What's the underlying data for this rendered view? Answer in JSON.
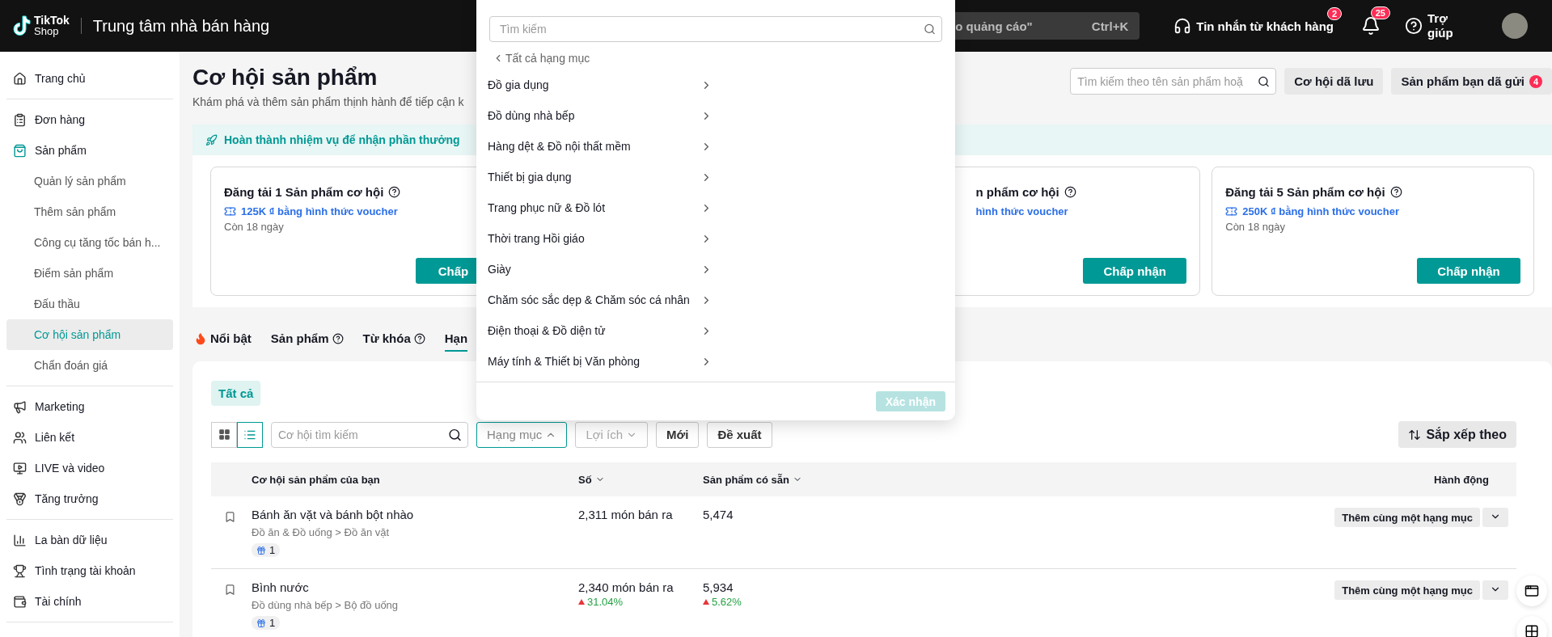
{
  "header": {
    "logo": "TikTok",
    "logo_sub": "Shop",
    "title": "Trung tâm nhà bán hàng",
    "search": {
      "value": "o quảng cáo\"",
      "shortcut": "Ctrl+K"
    },
    "messages": {
      "label": "Tin nhắn từ khách hàng",
      "badge": "2"
    },
    "notifications": {
      "badge": "25"
    },
    "help": {
      "label": "Trợ giúp"
    }
  },
  "sidebar": {
    "groups": [
      [
        {
          "label": "Trang chủ",
          "selected": false
        }
      ],
      [
        {
          "label": "Đơn hàng",
          "selected": false
        },
        {
          "label": "Sản phẩm",
          "selected": false,
          "expanded": true,
          "children": [
            {
              "label": "Quản lý sản phẩm",
              "selected": false
            },
            {
              "label": "Thêm sản phẩm",
              "selected": false
            },
            {
              "label": "Công cụ tăng tốc bán h...",
              "selected": false
            },
            {
              "label": "Điểm sản phẩm",
              "selected": false
            },
            {
              "label": "Đấu thầu",
              "selected": false
            },
            {
              "label": "Cơ hội sản phẩm",
              "selected": true
            },
            {
              "label": "Chẩn đoán giá",
              "selected": false
            }
          ]
        }
      ],
      [
        {
          "label": "Marketing",
          "selected": false
        },
        {
          "label": "Liên kết",
          "selected": false
        },
        {
          "label": "LIVE và video",
          "selected": false
        },
        {
          "label": "Tăng trưởng",
          "selected": false
        }
      ],
      [
        {
          "label": "La bàn dữ liệu",
          "selected": false
        },
        {
          "label": "Tình trạng tài khoản",
          "selected": false
        },
        {
          "label": "Tài chính",
          "selected": false
        }
      ]
    ]
  },
  "page": {
    "title": "Cơ hội sản phẩm",
    "subtitle": "Khám phá và thêm sản phẩm thịnh hành để tiếp cận k",
    "search": {
      "placeholder": "Tìm kiếm theo tên sản phẩm hoặ"
    },
    "buttons": [
      {
        "label": "Cơ hội dã lưu"
      },
      {
        "label": "Sản phẩm bạn dã gửi",
        "badge": "4"
      }
    ]
  },
  "mission": {
    "title": "Hoàn thành nhiệm vụ để nhận phần thưởng",
    "cards": [
      {
        "kind": "full",
        "title": "Đăng tải 1 Sản phẩm cơ hội",
        "voucher": "125K ₫ bằng hình thức voucher",
        "days": "Còn 18 ngày",
        "button": "Chấp"
      },
      {
        "kind": "cut",
        "title": "n phẩm cơ hội",
        "voucher": "hình thức voucher",
        "button": "Chấp nhận"
      },
      {
        "kind": "full",
        "title": "Đăng tải 5 Sản phẩm cơ hội",
        "voucher": "250K ₫ bằng hình thức voucher",
        "days": "Còn 18 ngày",
        "button": "Chấp nhận"
      }
    ]
  },
  "tabs": [
    {
      "label": "Nổi bật",
      "kind": "hot",
      "selected": false
    },
    {
      "label": "Sản phẩm",
      "kind": "help",
      "selected": false
    },
    {
      "label": "Từ khóa",
      "kind": "help",
      "selected": false
    },
    {
      "label": "Hạn",
      "kind": "plain",
      "selected": true
    }
  ],
  "filters": {
    "chips": [
      {
        "label": "Tất cả",
        "selected": true
      }
    ],
    "views": [
      {
        "selected": false
      },
      {
        "selected": true
      }
    ],
    "search": {
      "placeholder": "Cơ hội tìm kiếm"
    },
    "dropdowns": [
      {
        "label": "Hạng mục",
        "expanded": true,
        "disabled": false
      },
      {
        "label": "Lợi ích",
        "expanded": false,
        "disabled": true
      }
    ],
    "buttons": [
      "Mới",
      "Đề xuất"
    ],
    "sort": "Sắp xếp theo"
  },
  "table": {
    "columns": [
      {
        "label": "Cơ hội sản phẩm của bạn",
        "sortable": false
      },
      {
        "label": "Số",
        "sortable": true
      },
      {
        "label": "Sản phẩm có sẵn",
        "sortable": true
      },
      {
        "label": "Hành động",
        "sortable": false
      }
    ],
    "rows": [
      {
        "name": "Bánh ăn vặt và bánh bột nhào",
        "path": "Đồ ăn & Đồ uống > Đồ ăn vặt",
        "gifts": "1",
        "sold": "2,311 món bán ra",
        "available": "5,474",
        "action": "Thêm cùng một hạng mục"
      },
      {
        "name": "Bình nước",
        "path": "Đồ dùng nhà bếp > Bộ đồ uống",
        "gifts": "1",
        "sold": "2,340 món bán ra",
        "sold_change": "31.04%",
        "available": "5,934",
        "available_change": "5.62%",
        "action": "Thêm cùng một hạng mục"
      }
    ]
  },
  "category_menu": {
    "search": {
      "placeholder": "Tìm kiếm"
    },
    "back": "Tất cả hạng mục",
    "items": [
      "Đồ gia dụng",
      "Đồ dùng nhà bếp",
      "Hàng dệt & Đồ nội thất mềm",
      "Thiết bị gia dụng",
      "Trang phục nữ & Đồ lót",
      "Thời trang Hồi giáo",
      "Giày",
      "Chăm sóc sắc dẹp & Chăm sóc cá nhân",
      "Điện thoại & Đồ diện tử",
      "Máy tính & Thiết bị Văn phòng"
    ],
    "confirm": {
      "label": "Xác nhận",
      "disabled": true
    }
  }
}
